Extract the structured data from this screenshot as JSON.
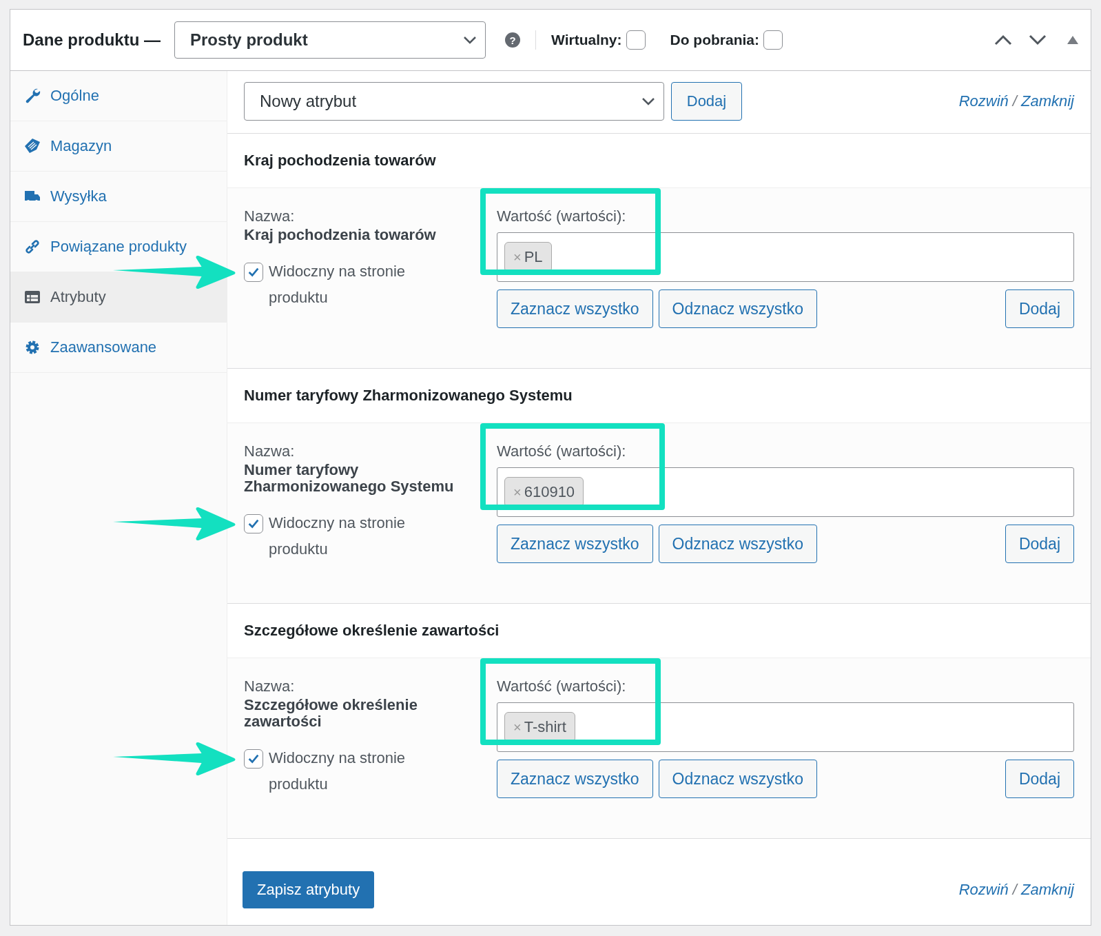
{
  "header": {
    "title": "Dane produktu —",
    "product_type": "Prosty produkt",
    "help": "?",
    "options": [
      {
        "label": "Wirtualny:",
        "checked": false
      },
      {
        "label": "Do pobrania:",
        "checked": false
      }
    ]
  },
  "sidebar": {
    "items": [
      {
        "label": "Ogólne",
        "kind": "wrench",
        "selected": false
      },
      {
        "label": "Magazyn",
        "kind": "tag",
        "selected": false
      },
      {
        "label": "Wysyłka",
        "kind": "truck",
        "selected": false
      },
      {
        "label": "Powiązane produkty",
        "kind": "link",
        "selected": false
      },
      {
        "label": "Atrybuty",
        "kind": "table",
        "selected": true
      },
      {
        "label": "Zaawansowane",
        "kind": "gear",
        "selected": false
      }
    ]
  },
  "toolbar": {
    "attribute_select": "Nowy atrybut",
    "add_button": "Dodaj",
    "expand_link": "Rozwiń",
    "separator": "/",
    "collapse_link": "Zamknij"
  },
  "attributes": [
    {
      "title": "Kraj pochodzenia towarów",
      "name_label": "Nazwa:",
      "name": "Kraj pochodzenia towarów",
      "visible_label": "Widoczny na stronie produktu",
      "visible": true,
      "values_label": "Wartość (wartości):",
      "values": [
        {
          "remove": "×",
          "text": "PL"
        }
      ],
      "select_all": "Zaznacz wszystko",
      "deselect_all": "Odznacz wszystko",
      "add": "Dodaj"
    },
    {
      "title": "Numer taryfowy Zharmonizowanego Systemu",
      "name_label": "Nazwa:",
      "name": "Numer taryfowy Zharmonizowanego Systemu",
      "visible_label": "Widoczny na stronie produktu",
      "visible": true,
      "values_label": "Wartość (wartości):",
      "values": [
        {
          "remove": "×",
          "text": "610910"
        }
      ],
      "select_all": "Zaznacz wszystko",
      "deselect_all": "Odznacz wszystko",
      "add": "Dodaj"
    },
    {
      "title": "Szczegółowe określenie zawartości",
      "name_label": "Nazwa:",
      "name": "Szczegółowe określenie zawartości",
      "visible_label": "Widoczny na stronie produktu",
      "visible": true,
      "values_label": "Wartość (wartości):",
      "values": [
        {
          "remove": "×",
          "text": "T-shirt"
        }
      ],
      "select_all": "Zaznacz wszystko",
      "deselect_all": "Odznacz wszystko",
      "add": "Dodaj"
    }
  ],
  "footer": {
    "save_button": "Zapisz atrybuty",
    "expand_link": "Rozwiń",
    "separator": "/",
    "collapse_link": "Zamknij"
  }
}
